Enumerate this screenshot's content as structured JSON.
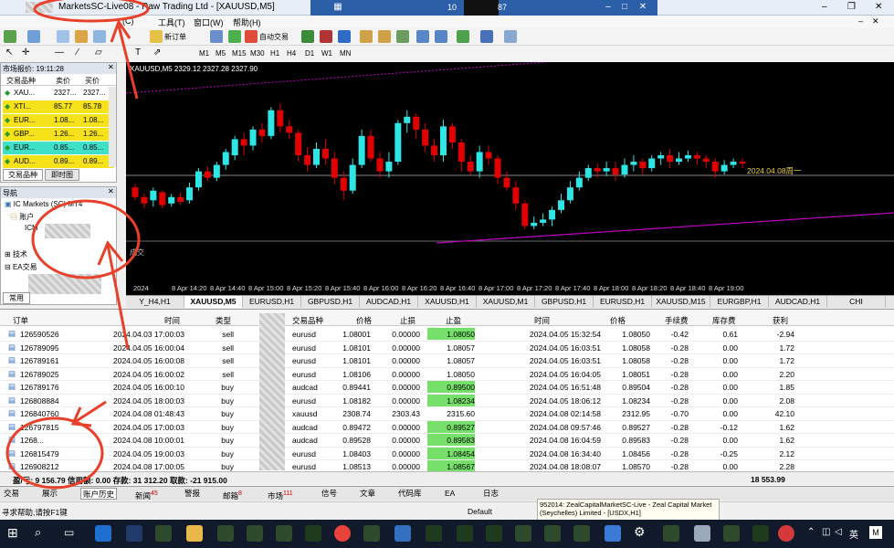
{
  "window": {
    "title": "MarketsSC-Live08 - Raw Trading Ltd - [XAUUSD,M5]",
    "right_title_a": "10",
    "right_title_b": "87"
  },
  "menu": [
    "(C)",
    "工具(T)",
    "窗口(W)",
    "帮助(H)"
  ],
  "toolbar": {
    "new_order": "新订单",
    "auto_trading": "自动交易",
    "timeframes": [
      "M1",
      "M5",
      "M15",
      "M30",
      "H1",
      "H4",
      "D1",
      "W1",
      "MN"
    ]
  },
  "market_watch": {
    "header": "市场报价: 19:11:28",
    "columns": [
      "交易品种",
      "卖价",
      "买价"
    ],
    "rows": [
      {
        "symbol": "XAU...",
        "bid": "2327...",
        "ask": "2327...",
        "color": "#ffffff"
      },
      {
        "symbol": "XTI...",
        "bid": "85.77",
        "ask": "85.78",
        "color": "#f5e21a"
      },
      {
        "symbol": "EUR...",
        "bid": "1.08...",
        "ask": "1.08...",
        "color": "#f5e21a"
      },
      {
        "symbol": "GBP...",
        "bid": "1.26...",
        "ask": "1.26...",
        "color": "#f5e21a"
      },
      {
        "symbol": "EUR...",
        "bid": "0.85...",
        "ask": "0.85...",
        "color": "#3fe0c8"
      },
      {
        "symbol": "AUD...",
        "bid": "0.89...",
        "ask": "0.89...",
        "color": "#f5e21a"
      }
    ],
    "tabs": [
      "交易品种",
      "即时图"
    ]
  },
  "navigator": {
    "header": "导航",
    "items": [
      "IC Markets (SC) MT4",
      "账户",
      "ICM",
      "技术",
      "EA交易"
    ],
    "tabs": [
      "常用"
    ]
  },
  "chart": {
    "info": "XAUUSD,M5  2329.12 2327.28 2327.90",
    "date_label": "2024.04.08周一",
    "sub_label": "成交",
    "time_labels": [
      "2024",
      "8 Apr 14:20",
      "8 Apr 14:40",
      "8 Apr 15:00",
      "8 Apr 15:20",
      "8 Apr 15:40",
      "8 Apr 16:00",
      "8 Apr 16:20",
      "8 Apr 16:40",
      "8 Apr 17:00",
      "8 Apr 17:20",
      "8 Apr 17:40",
      "8 Apr 18:00",
      "8 Apr 18:20",
      "8 Apr 18:40",
      "8 Apr 19:00"
    ],
    "candles": [
      [
        0.3,
        0.24,
        0.22,
        0.32
      ],
      [
        0.24,
        0.2,
        0.17,
        0.26
      ],
      [
        0.22,
        0.28,
        0.18,
        0.3
      ],
      [
        0.27,
        0.19,
        0.17,
        0.28
      ],
      [
        0.2,
        0.24,
        0.18,
        0.26
      ],
      [
        0.24,
        0.21,
        0.19,
        0.27
      ],
      [
        0.22,
        0.3,
        0.2,
        0.33
      ],
      [
        0.3,
        0.4,
        0.28,
        0.42
      ],
      [
        0.4,
        0.36,
        0.34,
        0.43
      ],
      [
        0.36,
        0.44,
        0.34,
        0.46
      ],
      [
        0.44,
        0.52,
        0.41,
        0.54
      ],
      [
        0.5,
        0.6,
        0.47,
        0.62
      ],
      [
        0.6,
        0.56,
        0.5,
        0.64
      ],
      [
        0.56,
        0.66,
        0.53,
        0.68
      ],
      [
        0.66,
        0.62,
        0.58,
        0.7
      ],
      [
        0.62,
        0.78,
        0.6,
        0.8
      ],
      [
        0.78,
        0.68,
        0.64,
        0.82
      ],
      [
        0.68,
        0.64,
        0.6,
        0.72
      ],
      [
        0.64,
        0.5,
        0.46,
        0.66
      ],
      [
        0.5,
        0.44,
        0.4,
        0.55
      ],
      [
        0.44,
        0.54,
        0.42,
        0.58
      ],
      [
        0.54,
        0.48,
        0.44,
        0.6
      ],
      [
        0.48,
        0.36,
        0.32,
        0.52
      ],
      [
        0.36,
        0.28,
        0.22,
        0.4
      ],
      [
        0.28,
        0.44,
        0.26,
        0.48
      ],
      [
        0.44,
        0.62,
        0.42,
        0.66
      ],
      [
        0.62,
        0.48,
        0.46,
        0.66
      ],
      [
        0.48,
        0.4,
        0.36,
        0.52
      ],
      [
        0.4,
        0.46,
        0.36,
        0.52
      ],
      [
        0.46,
        0.7,
        0.44,
        0.72
      ],
      [
        0.7,
        0.74,
        0.64,
        0.78
      ],
      [
        0.74,
        0.66,
        0.6,
        0.76
      ],
      [
        0.66,
        0.56,
        0.52,
        0.7
      ],
      [
        0.56,
        0.5,
        0.46,
        0.6
      ],
      [
        0.5,
        0.68,
        0.46,
        0.72
      ],
      [
        0.68,
        0.58,
        0.54,
        0.7
      ],
      [
        0.58,
        0.46,
        0.4,
        0.6
      ],
      [
        0.46,
        0.4,
        0.38,
        0.5
      ],
      [
        0.4,
        0.52,
        0.36,
        0.56
      ],
      [
        0.52,
        0.48,
        0.44,
        0.56
      ],
      [
        0.48,
        0.36,
        0.32,
        0.5
      ],
      [
        0.36,
        0.3,
        0.28,
        0.4
      ],
      [
        0.3,
        0.2,
        0.16,
        0.34
      ],
      [
        0.2,
        0.06,
        0.04,
        0.22
      ],
      [
        0.06,
        0.08,
        0.04,
        0.12
      ],
      [
        0.08,
        0.1,
        0.06,
        0.14
      ],
      [
        0.1,
        0.16,
        0.06,
        0.18
      ],
      [
        0.16,
        0.22,
        0.14,
        0.26
      ],
      [
        0.22,
        0.3,
        0.2,
        0.34
      ],
      [
        0.3,
        0.36,
        0.28,
        0.4
      ],
      [
        0.36,
        0.42,
        0.34,
        0.44
      ],
      [
        0.42,
        0.4,
        0.36,
        0.45
      ],
      [
        0.4,
        0.42,
        0.37,
        0.46
      ],
      [
        0.42,
        0.38,
        0.34,
        0.46
      ],
      [
        0.38,
        0.44,
        0.36,
        0.48
      ],
      [
        0.44,
        0.46,
        0.4,
        0.5
      ],
      [
        0.46,
        0.42,
        0.38,
        0.48
      ],
      [
        0.42,
        0.48,
        0.4,
        0.5
      ],
      [
        0.48,
        0.5,
        0.44,
        0.52
      ],
      [
        0.5,
        0.46,
        0.42,
        0.54
      ],
      [
        0.46,
        0.48,
        0.44,
        0.52
      ],
      [
        0.48,
        0.5,
        0.46,
        0.53
      ],
      [
        0.5,
        0.48,
        0.44,
        0.52
      ],
      [
        0.48,
        0.46,
        0.42,
        0.5
      ],
      [
        0.46,
        0.4,
        0.36,
        0.48
      ],
      [
        0.4,
        0.44,
        0.38,
        0.47
      ],
      [
        0.44,
        0.46,
        0.42,
        0.48
      ],
      [
        0.46,
        0.45,
        0.42,
        0.48
      ]
    ],
    "tabs": [
      "Y_H4,H1",
      "XAUUSD,M5",
      "EURUSD,H1",
      "GBPUSD,H1",
      "AUDCAD,H1",
      "XAUUSD,H1",
      "XAUUSD,M1",
      "GBPUSD,H1",
      "EURUSD,H1",
      "XAUUSD,M15",
      "EURGBP,H1",
      "AUDCAD,H1",
      "CHI"
    ]
  },
  "terminal": {
    "columns": [
      "订单",
      "时间",
      "类型",
      "交易品种",
      "价格",
      "止损",
      "止盈",
      "时间",
      "价格",
      "手续费",
      "库存费",
      "获利"
    ],
    "rows": [
      [
        "126590526",
        "2024.04.03 17:00:03",
        "sell",
        "eurusd",
        "1.08001",
        "0.00000",
        "1.08050",
        "2024.04.05 15:32:54",
        "1.08050",
        "-0.42",
        "0.61",
        "-2.94"
      ],
      [
        "126789095",
        "2024.04.05 16:00:04",
        "sell",
        "eurusd",
        "1.08101",
        "0.00000",
        "1.08057",
        "2024.04.05 16:03:51",
        "1.08058",
        "-0.28",
        "0.00",
        "1.72"
      ],
      [
        "126789161",
        "2024.04.05 16:00:08",
        "sell",
        "eurusd",
        "1.08101",
        "0.00000",
        "1.08057",
        "2024.04.05 16:03:51",
        "1.08058",
        "-0.28",
        "0.00",
        "1.72"
      ],
      [
        "126789025",
        "2024.04.05 16:00:02",
        "sell",
        "eurusd",
        "1.08106",
        "0.00000",
        "1.08050",
        "2024.04.05 16:04:05",
        "1.08051",
        "-0.28",
        "0.00",
        "2.20"
      ],
      [
        "126789176",
        "2024.04.05 16:00:10",
        "buy",
        "audcad",
        "0.89441",
        "0.00000",
        "0.89500",
        "2024.04.05 16:51:48",
        "0.89504",
        "-0.28",
        "0.00",
        "1.85"
      ],
      [
        "126808884",
        "2024.04.05 18:00:03",
        "buy",
        "eurusd",
        "1.08182",
        "0.00000",
        "1.08234",
        "2024.04.05 18:06:12",
        "1.08234",
        "-0.28",
        "0.00",
        "2.08"
      ],
      [
        "126840760",
        "2024.04.08 01:48:43",
        "buy",
        "xauusd",
        "2308.74",
        "2303.43",
        "2315.60",
        "2024.04.08 02:14:58",
        "2312.95",
        "-0.70",
        "0.00",
        "42.10"
      ],
      [
        "126797815",
        "2024.04.05 17:00:03",
        "buy",
        "audcad",
        "0.89472",
        "0.00000",
        "0.89527",
        "2024.04.08 09:57:46",
        "0.89527",
        "-0.28",
        "-0.12",
        "1.62"
      ],
      [
        "1268...",
        "2024.04.08 10:00:01",
        "buy",
        "audcad",
        "0.89528",
        "0.00000",
        "0.89583",
        "2024.04.08 16:04:59",
        "0.89583",
        "-0.28",
        "0.00",
        "1.62"
      ],
      [
        "126815479",
        "2024.04.05 19:00:03",
        "buy",
        "eurusd",
        "1.08403",
        "0.00000",
        "1.08454",
        "2024.04.08 16:34:40",
        "1.08456",
        "-0.28",
        "-0.25",
        "2.12"
      ],
      [
        "126908212",
        "2024.04.08 17:00:05",
        "buy",
        "eurusd",
        "1.08513",
        "0.00000",
        "1.08567",
        "2024.04.08 18:08:07",
        "1.08570",
        "-0.28",
        "0.00",
        "2.28"
      ]
    ],
    "highlight_tp": [
      true,
      false,
      false,
      false,
      true,
      true,
      false,
      true,
      true,
      true,
      true
    ],
    "summary_left": "盈/亏: 9 156.79  信用额: 0.00  存款: 31 312.20  取款: -21 915.00",
    "summary_right": "18 553.99",
    "tabs": [
      {
        "label": "交易",
        "badge": ""
      },
      {
        "label": "展示",
        "badge": ""
      },
      {
        "label": "账户历史",
        "badge": ""
      },
      {
        "label": "新闻",
        "badge": "45"
      },
      {
        "label": "警报",
        "badge": ""
      },
      {
        "label": "邮箱",
        "badge": "8"
      },
      {
        "label": "市场",
        "badge": "111"
      },
      {
        "label": "信号",
        "badge": ""
      },
      {
        "label": "文章",
        "badge": ""
      },
      {
        "label": "代码库",
        "badge": ""
      },
      {
        "label": "EA",
        "badge": ""
      },
      {
        "label": "日志",
        "badge": ""
      }
    ]
  },
  "status": {
    "left": "寻求帮助,请按F1键",
    "middle": "Default",
    "popup": "952014: ZealCapitalMarketSC-Live - Zeal Capital Market (Seychelles) Limited - [USDX,H1]"
  },
  "taskbar": {
    "ime": "英",
    "lang": "M"
  },
  "colors": {
    "bull": "#2ee6e6",
    "bear": "#e00000",
    "tp_highlight": "#77e06a",
    "annotation": "#e8402a",
    "trendline": "#c000c0"
  }
}
